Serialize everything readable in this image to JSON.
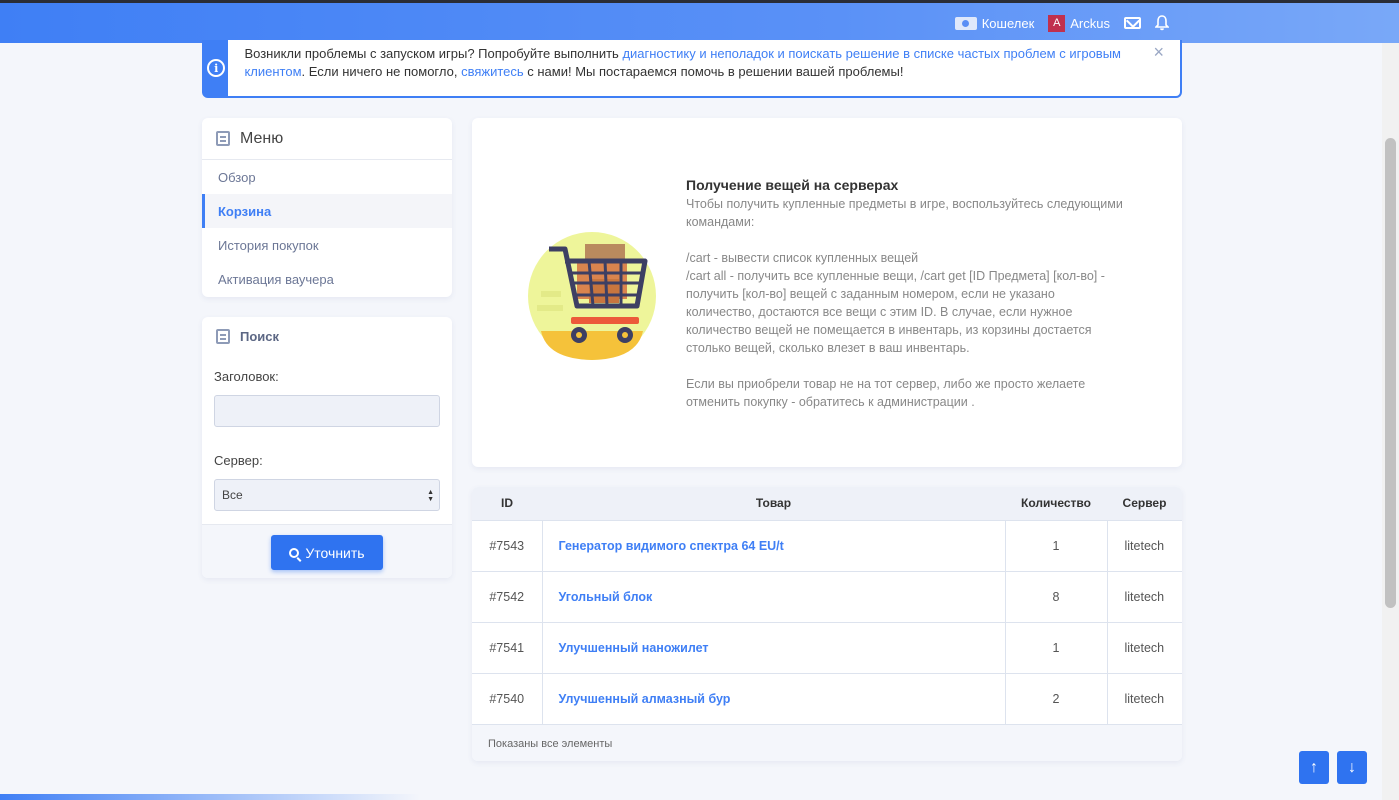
{
  "topbar": {
    "wallet_label": "Кошелек",
    "avatar_letter": "A",
    "username": "Arckus",
    "icons": [
      "wallet-icon",
      "mail-icon",
      "bell-icon"
    ]
  },
  "alert": {
    "text_1": "Возникли проблемы с запуском игры? Попробуйте выполнить ",
    "link_1": "диагностику и неполадок и поискать решение в списке частых проблем с игровым клиентом",
    "text_2": ". Если ничего не помогло, ",
    "link_2": "свяжитесь",
    "text_3": " с нами! Мы постараемся помочь в решении вашей проблемы!",
    "close": "×"
  },
  "menu": {
    "title": "Меню",
    "items": [
      {
        "label": "Обзор"
      },
      {
        "label": "Корзина"
      },
      {
        "label": "История покупок"
      },
      {
        "label": "Активация ваучера"
      }
    ]
  },
  "search": {
    "title": "Поиск",
    "title_label": "Заголовок:",
    "title_value": "",
    "server_label": "Сервер:",
    "server_value": "Все",
    "button": "Уточнить"
  },
  "info": {
    "title": "Получение вещей на серверах",
    "line_1": "Чтобы получить купленные предметы в игре, воспользуйтесь следующими командами:",
    "line_2": "/cart - вывести список купленных вещей",
    "line_3": "/cart all - получить все купленные вещи, /cart get [ID Предмета] [кол-во] - получить [кол-во] вещей с заданным номером, если не указано количество, достаются все вещи с этим ID. В случае, если нужное количество вещей не помещается в инвентарь, из корзины достается столько вещей, сколько влезет в ваш инвентарь.",
    "line_4": "Если вы приобрели товар не на тот сервер, либо же просто желаете отменить покупку - обратитесь к администрации ."
  },
  "table": {
    "headers": {
      "id": "ID",
      "item": "Товар",
      "qty": "Количество",
      "server": "Сервер"
    },
    "rows": [
      {
        "id": "#7543",
        "item": "Генератор видимого спектра 64 EU/t",
        "qty": "1",
        "server": "litetech"
      },
      {
        "id": "#7542",
        "item": "Угольный блок",
        "qty": "8",
        "server": "litetech"
      },
      {
        "id": "#7541",
        "item": "Улучшенный наножилет",
        "qty": "1",
        "server": "litetech"
      },
      {
        "id": "#7540",
        "item": "Улучшенный алмазный бур",
        "qty": "2",
        "server": "litetech"
      }
    ],
    "footer": "Показаны все элементы"
  },
  "scroll_buttons": {
    "up": "↑",
    "down": "↓"
  },
  "colors": {
    "accent": "#3f7ff5",
    "button": "#2f73f0",
    "background": "#f4f6fb"
  }
}
